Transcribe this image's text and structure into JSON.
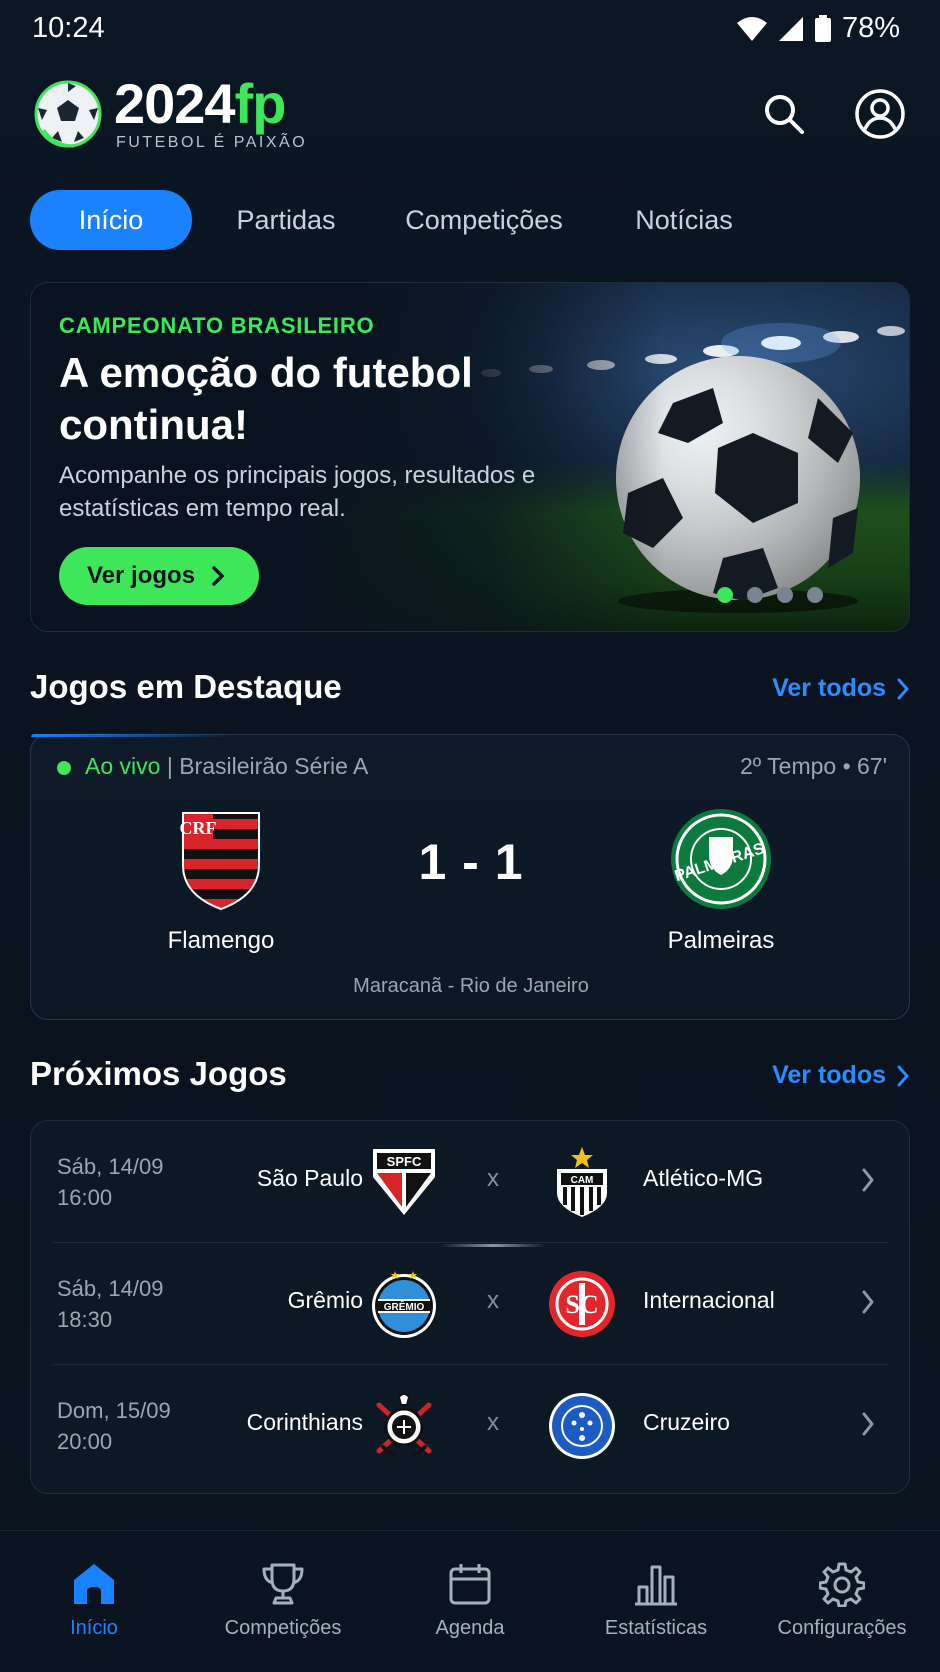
{
  "status_bar": {
    "time": "10:24",
    "battery": "78%"
  },
  "header": {
    "logo_main": "2024",
    "logo_accent": "fp",
    "tagline": "FUTEBOL É PAIXÃO",
    "icons": [
      "search-icon",
      "profile-icon"
    ]
  },
  "tabs": [
    {
      "label": "Início",
      "active": true
    },
    {
      "label": "Partidas",
      "active": false
    },
    {
      "label": "Competições",
      "active": false
    },
    {
      "label": "Notícias",
      "active": false
    }
  ],
  "hero": {
    "kicker": "CAMPEONATO BRASILEIRO",
    "title": "A emoção do futebol continua!",
    "subtitle": "Acompanhe os principais jogos, resultados e estatísticas em tempo real.",
    "button": "Ver jogos",
    "slides_total": 4,
    "slide_active": 1
  },
  "featured": {
    "section_title": "Jogos em Destaque",
    "see_all": "Ver todos",
    "live_label": "Ao vivo",
    "competition": "| Brasileirão Série A",
    "time": "2º Tempo • 67'",
    "home_team": "Flamengo",
    "away_team": "Palmeiras",
    "score": "1 - 1",
    "venue": "Maracanã - Rio de Janeiro"
  },
  "upcoming": {
    "section_title": "Próximos Jogos",
    "see_all": "Ver todos",
    "vs": "x",
    "matches": [
      {
        "date": "Sáb, 14/09",
        "time": "16:00",
        "home": "São Paulo",
        "away": "Atlético-MG"
      },
      {
        "date": "Sáb, 14/09",
        "time": "18:30",
        "home": "Grêmio",
        "away": "Internacional"
      },
      {
        "date": "Dom, 15/09",
        "time": "20:00",
        "home": "Corinthians",
        "away": "Cruzeiro"
      }
    ]
  },
  "bottom_nav": [
    {
      "label": "Início",
      "icon": "home-icon",
      "active": true
    },
    {
      "label": "Competições",
      "icon": "trophy-icon",
      "active": false
    },
    {
      "label": "Agenda",
      "icon": "calendar-icon",
      "active": false
    },
    {
      "label": "Estatísticas",
      "icon": "bar-chart-icon",
      "active": false
    },
    {
      "label": "Configurações",
      "icon": "gear-icon",
      "active": false
    }
  ],
  "colors": {
    "accent_green": "#3ee65a",
    "accent_blue": "#1a82ff",
    "background": "#0a1421"
  }
}
